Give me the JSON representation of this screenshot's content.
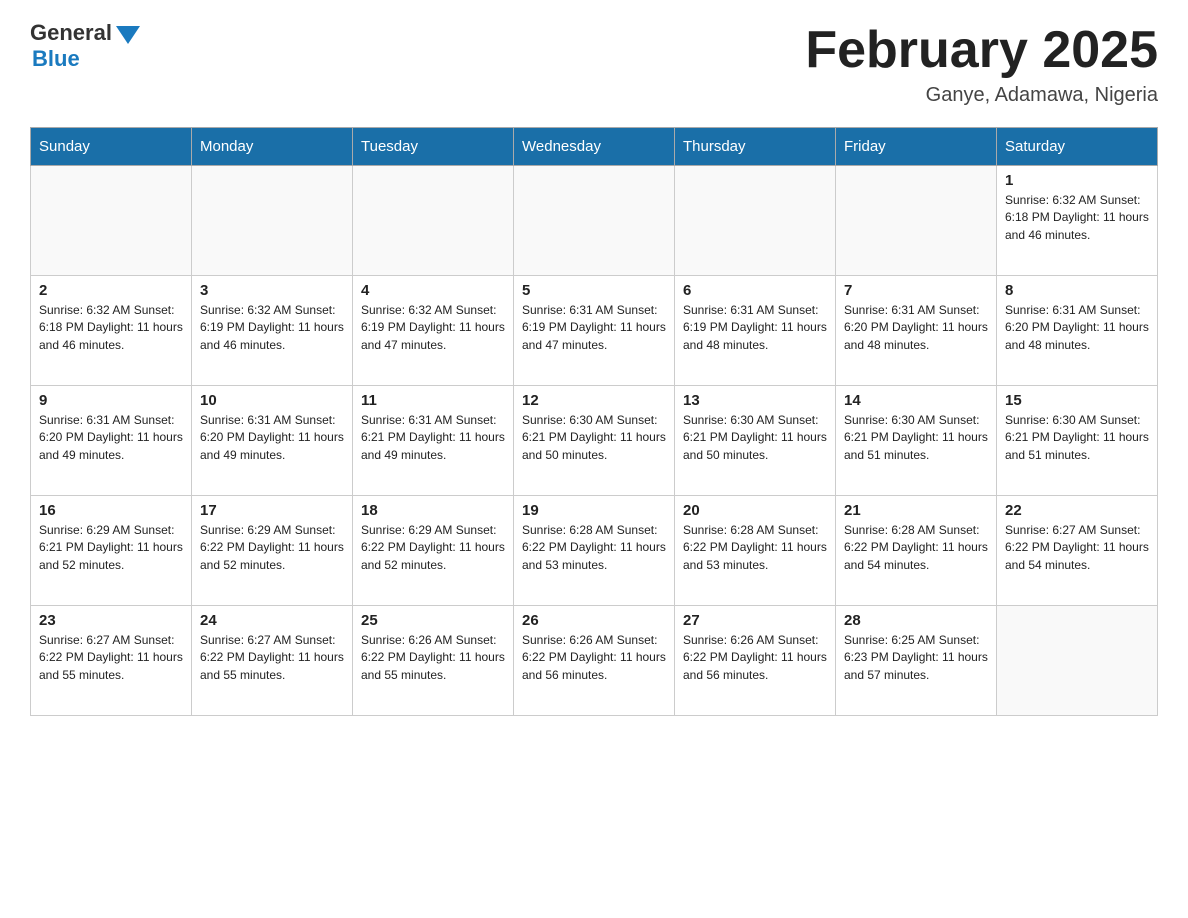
{
  "header": {
    "logo_general": "General",
    "logo_blue": "Blue",
    "month_title": "February 2025",
    "location": "Ganye, Adamawa, Nigeria"
  },
  "weekdays": [
    "Sunday",
    "Monday",
    "Tuesday",
    "Wednesday",
    "Thursday",
    "Friday",
    "Saturday"
  ],
  "weeks": [
    [
      {
        "day": "",
        "info": ""
      },
      {
        "day": "",
        "info": ""
      },
      {
        "day": "",
        "info": ""
      },
      {
        "day": "",
        "info": ""
      },
      {
        "day": "",
        "info": ""
      },
      {
        "day": "",
        "info": ""
      },
      {
        "day": "1",
        "info": "Sunrise: 6:32 AM\nSunset: 6:18 PM\nDaylight: 11 hours and 46 minutes."
      }
    ],
    [
      {
        "day": "2",
        "info": "Sunrise: 6:32 AM\nSunset: 6:18 PM\nDaylight: 11 hours and 46 minutes."
      },
      {
        "day": "3",
        "info": "Sunrise: 6:32 AM\nSunset: 6:19 PM\nDaylight: 11 hours and 46 minutes."
      },
      {
        "day": "4",
        "info": "Sunrise: 6:32 AM\nSunset: 6:19 PM\nDaylight: 11 hours and 47 minutes."
      },
      {
        "day": "5",
        "info": "Sunrise: 6:31 AM\nSunset: 6:19 PM\nDaylight: 11 hours and 47 minutes."
      },
      {
        "day": "6",
        "info": "Sunrise: 6:31 AM\nSunset: 6:19 PM\nDaylight: 11 hours and 48 minutes."
      },
      {
        "day": "7",
        "info": "Sunrise: 6:31 AM\nSunset: 6:20 PM\nDaylight: 11 hours and 48 minutes."
      },
      {
        "day": "8",
        "info": "Sunrise: 6:31 AM\nSunset: 6:20 PM\nDaylight: 11 hours and 48 minutes."
      }
    ],
    [
      {
        "day": "9",
        "info": "Sunrise: 6:31 AM\nSunset: 6:20 PM\nDaylight: 11 hours and 49 minutes."
      },
      {
        "day": "10",
        "info": "Sunrise: 6:31 AM\nSunset: 6:20 PM\nDaylight: 11 hours and 49 minutes."
      },
      {
        "day": "11",
        "info": "Sunrise: 6:31 AM\nSunset: 6:21 PM\nDaylight: 11 hours and 49 minutes."
      },
      {
        "day": "12",
        "info": "Sunrise: 6:30 AM\nSunset: 6:21 PM\nDaylight: 11 hours and 50 minutes."
      },
      {
        "day": "13",
        "info": "Sunrise: 6:30 AM\nSunset: 6:21 PM\nDaylight: 11 hours and 50 minutes."
      },
      {
        "day": "14",
        "info": "Sunrise: 6:30 AM\nSunset: 6:21 PM\nDaylight: 11 hours and 51 minutes."
      },
      {
        "day": "15",
        "info": "Sunrise: 6:30 AM\nSunset: 6:21 PM\nDaylight: 11 hours and 51 minutes."
      }
    ],
    [
      {
        "day": "16",
        "info": "Sunrise: 6:29 AM\nSunset: 6:21 PM\nDaylight: 11 hours and 52 minutes."
      },
      {
        "day": "17",
        "info": "Sunrise: 6:29 AM\nSunset: 6:22 PM\nDaylight: 11 hours and 52 minutes."
      },
      {
        "day": "18",
        "info": "Sunrise: 6:29 AM\nSunset: 6:22 PM\nDaylight: 11 hours and 52 minutes."
      },
      {
        "day": "19",
        "info": "Sunrise: 6:28 AM\nSunset: 6:22 PM\nDaylight: 11 hours and 53 minutes."
      },
      {
        "day": "20",
        "info": "Sunrise: 6:28 AM\nSunset: 6:22 PM\nDaylight: 11 hours and 53 minutes."
      },
      {
        "day": "21",
        "info": "Sunrise: 6:28 AM\nSunset: 6:22 PM\nDaylight: 11 hours and 54 minutes."
      },
      {
        "day": "22",
        "info": "Sunrise: 6:27 AM\nSunset: 6:22 PM\nDaylight: 11 hours and 54 minutes."
      }
    ],
    [
      {
        "day": "23",
        "info": "Sunrise: 6:27 AM\nSunset: 6:22 PM\nDaylight: 11 hours and 55 minutes."
      },
      {
        "day": "24",
        "info": "Sunrise: 6:27 AM\nSunset: 6:22 PM\nDaylight: 11 hours and 55 minutes."
      },
      {
        "day": "25",
        "info": "Sunrise: 6:26 AM\nSunset: 6:22 PM\nDaylight: 11 hours and 55 minutes."
      },
      {
        "day": "26",
        "info": "Sunrise: 6:26 AM\nSunset: 6:22 PM\nDaylight: 11 hours and 56 minutes."
      },
      {
        "day": "27",
        "info": "Sunrise: 6:26 AM\nSunset: 6:22 PM\nDaylight: 11 hours and 56 minutes."
      },
      {
        "day": "28",
        "info": "Sunrise: 6:25 AM\nSunset: 6:23 PM\nDaylight: 11 hours and 57 minutes."
      },
      {
        "day": "",
        "info": ""
      }
    ]
  ]
}
